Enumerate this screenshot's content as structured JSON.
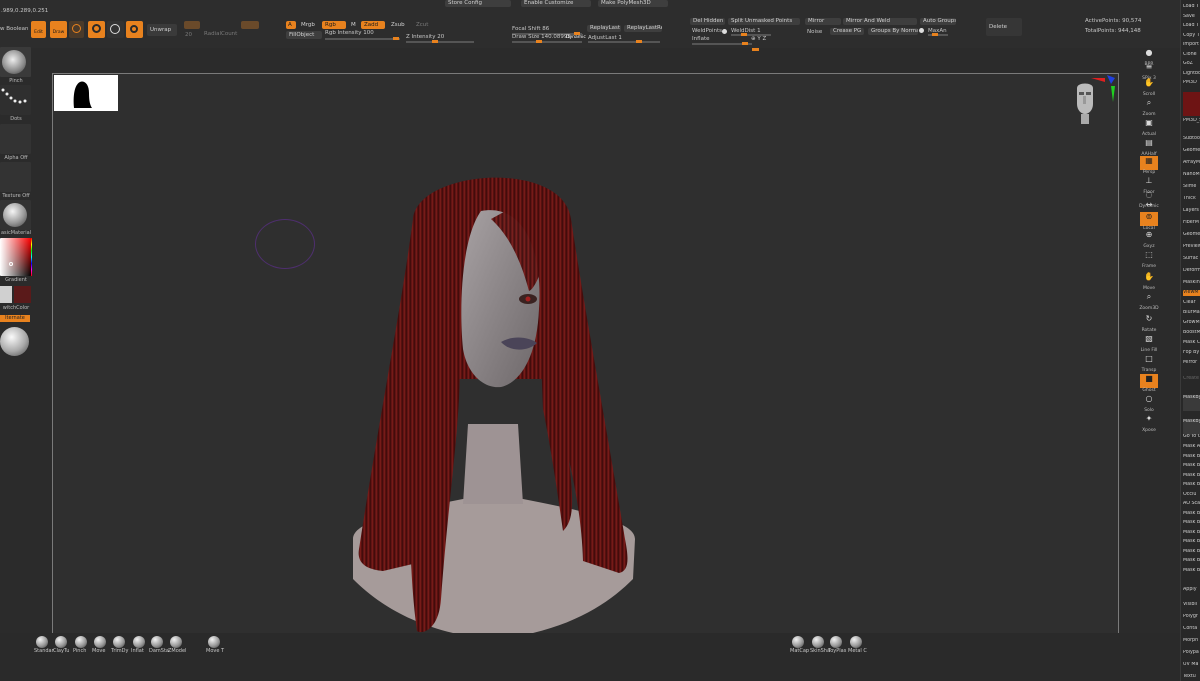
{
  "top": {
    "coords": ".989,0.289,0.251",
    "boolean_label": "w Boolean",
    "edit": "Edit",
    "draw": "Draw",
    "unwrap": "Unwrap",
    "rgb_mode": "A",
    "mrgb": "Mrgb",
    "rgb": "Rgb",
    "m": "M",
    "zadd": "Zadd",
    "zsub": "Zsub",
    "zcut": "Zcut",
    "fill_object": "FillObject",
    "rgb_intensity_label": "Rgb Intensity",
    "rgb_intensity_value": "100",
    "z_intensity_label": "Z Intensity",
    "z_intensity_value": "20",
    "radial_count": "RadialCount",
    "radial_num": "20",
    "store_config": "Store Config",
    "enable_customize": "Enable Customize",
    "make_polymesh": "Make PolyMesh3D",
    "focal_shift_label": "Focal Shift",
    "focal_shift_value": "86",
    "draw_size_label": "Draw Size",
    "draw_size_value": "140.08999",
    "dynamic": "Dynamic",
    "replay_last": "ReplayLast",
    "replay_last_rel": "ReplayLastRel",
    "adjust_last": "AdjustLast",
    "adjust_last_value": "1",
    "del_hidden": "Del Hidden",
    "split_unmasked": "Split Unmasked Points",
    "weld_points": "WeldPoints",
    "weld_dist": "WeldDist",
    "weld_dist_value": "1",
    "inflate": "Inflate",
    "xyz": "⊕ Y Z",
    "mirror": "Mirror",
    "mirror_and_weld": "Mirror And Weld",
    "auto_groups": "Auto Groups",
    "noise": "Noise",
    "crease_pg": "Crease PG",
    "groups_by_normals": "Groups By Normals",
    "maxan": "MaxAn",
    "delete": "Delete",
    "active_points": "ActivePoints: 90,574",
    "total_points": "TotalPoints: 944,148"
  },
  "left": {
    "brush_label": "Pinch",
    "stroke_label": "Dots",
    "alpha_label": "Alpha Off",
    "texture_label": "Texture Off",
    "material_label": "asicMaterial",
    "gradient_label": "Gradient",
    "switch_color": "witchColor",
    "alternate": "lternate"
  },
  "right_shelf": [
    {
      "label": "BPR",
      "icon": "bpr-icon"
    },
    {
      "label": "SPix 3",
      "icon": "spix-icon"
    },
    {
      "label": "Scroll",
      "icon": "scroll-icon"
    },
    {
      "label": "Zoom",
      "icon": "zoom-icon"
    },
    {
      "label": "Actual",
      "icon": "actual-icon"
    },
    {
      "label": "AAHalf",
      "icon": "aahalf-icon"
    },
    {
      "label": "Persp",
      "icon": "persp-icon"
    },
    {
      "label": "Floor",
      "icon": "floor-icon"
    },
    {
      "label": "Dynamic",
      "icon": "dynamic-icon"
    },
    {
      "label": "L.Sym",
      "icon": "lsym-icon"
    },
    {
      "label": "Local",
      "icon": "local-icon"
    },
    {
      "label": "Gxyz",
      "icon": "gxyz-icon"
    },
    {
      "label": "Frame",
      "icon": "frame-icon"
    },
    {
      "label": "Move",
      "icon": "move-icon"
    },
    {
      "label": "Zoom3D",
      "icon": "zoom3d-icon"
    },
    {
      "label": "Rotate",
      "icon": "rotate-icon"
    },
    {
      "label": "Line Fill",
      "icon": "linefill-icon"
    },
    {
      "label": "Transp",
      "icon": "transp-icon"
    },
    {
      "label": "Ghost",
      "icon": "ghost-icon"
    },
    {
      "label": "Solo",
      "icon": "solo-icon"
    },
    {
      "label": "Xpose",
      "icon": "xpose-icon"
    }
  ],
  "right_panel": {
    "top_items": [
      "Load T",
      "Save",
      "Load T",
      "Copy T",
      "Import",
      "Clone",
      "GoZ",
      "Lightbo",
      "PM3D"
    ],
    "pm3d_label": "PM3D_S",
    "sections": [
      "Subtoo",
      "Geome",
      "ArrayM",
      "NanoM",
      "Slime",
      "Thick",
      "Layers",
      "FiberM",
      "Geome",
      "Preview",
      "Surfac",
      "Deform",
      "Maskin"
    ],
    "viewmask": "ViewM",
    "mask_items": [
      "Clear",
      "BlurMa",
      "GrowM",
      "BoostM",
      "Mask C",
      "Fop By",
      "Mirror"
    ],
    "create": "Create",
    "maskby1": "MaskBy",
    "maskby2": "MaskBy",
    "goto": "Go To U",
    "mask_list": [
      "Mask A",
      "Mask B",
      "Mask B",
      "Mask B",
      "Mask B",
      "Occlu",
      "AO Sca",
      "Mask B",
      "Mask B",
      "Mask B",
      "Mask B",
      "Mask B",
      "Mask B",
      "Mask B"
    ],
    "apply": "Apply",
    "lower": [
      "Visibil",
      "Polygr",
      "Conta",
      "Morph",
      "Polypa",
      "UV Ma",
      "Textu"
    ]
  },
  "bottom": {
    "brushes": [
      "Standar",
      "ClayTu",
      "Pinch",
      "Move",
      "TrimDy",
      "Inflat",
      "DamSta",
      "ZModel"
    ],
    "move_t": "Move T",
    "materials": [
      "MatCap",
      "SkinSha",
      "ToyPlas",
      "Metal C"
    ]
  },
  "colors": {
    "accent": "#e8821e",
    "hair": "#6e1414",
    "skin": "#8f8a8c",
    "secondary_swatch": "#5a1a1a"
  }
}
